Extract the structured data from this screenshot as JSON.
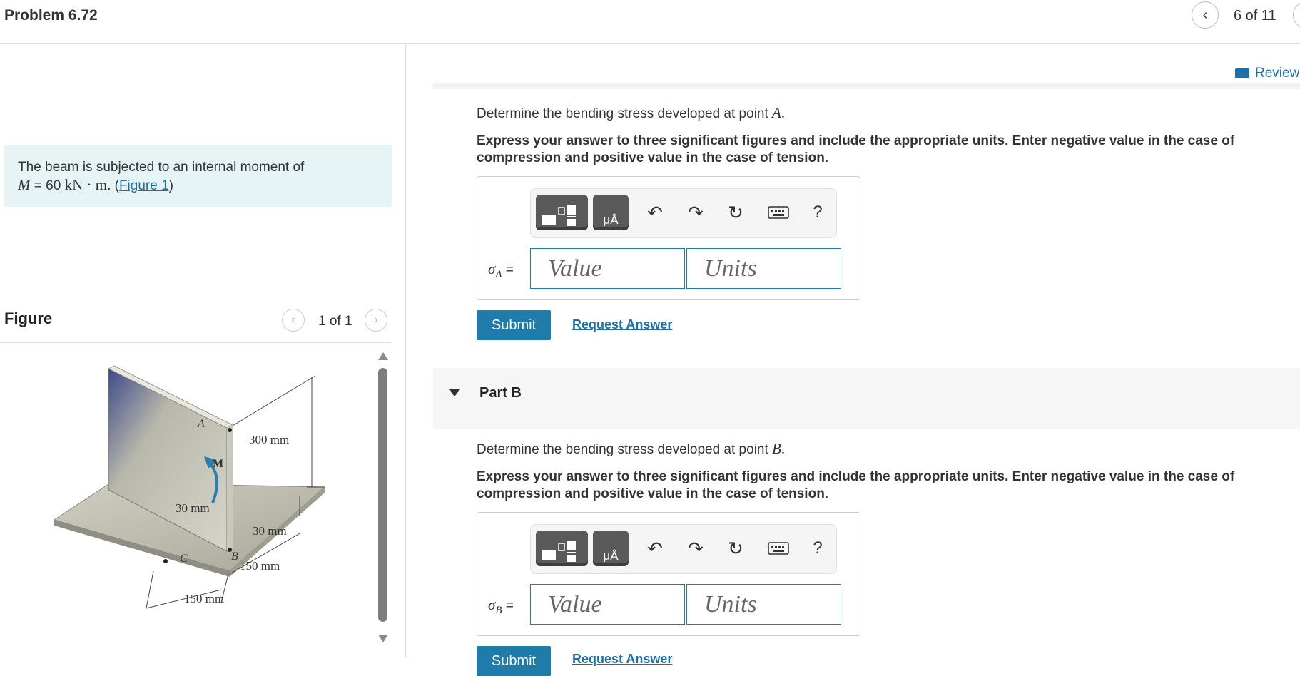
{
  "header": {
    "title": "Problem 6.72",
    "count": "6 of 11"
  },
  "prompt": {
    "text": "The beam is subjected to an internal moment of",
    "eq_var": "M",
    "eq_rest": " = 60 ",
    "eq_unit": "kN · m.",
    "figure_link": "Figure 1",
    "open_paren": " (",
    "close_paren": ")"
  },
  "figure_panel": {
    "label": "Figure",
    "count": "1 of 1",
    "labels": {
      "a": "A",
      "b": "B",
      "c": "C",
      "m": "M",
      "d300": "300 mm",
      "d30a": "30 mm",
      "d30b": "30 mm",
      "d150a": "150 mm",
      "d150b": "150 mm"
    }
  },
  "review": {
    "label": "Review"
  },
  "part_a": {
    "question": "Determine the bending stress developed at point ",
    "point": "A",
    "instructions": "Express your answer to three significant figures and include the appropriate units. Enter negative value in the case of compression and positive value in the case of tension.",
    "sigma": "σ",
    "sub": "A",
    "eq": " =",
    "value_placeholder": "Value",
    "units_placeholder": "Units",
    "submit": "Submit",
    "request": "Request Answer"
  },
  "part_b": {
    "heading": "Part B",
    "question": "Determine the bending stress developed at point ",
    "point": "B",
    "instructions": "Express your answer to three significant figures and include the appropriate units. Enter negative value in the case of compression and positive value in the case of tension.",
    "sigma": "σ",
    "sub": "B",
    "eq": " =",
    "value_placeholder": "Value",
    "units_placeholder": "Units",
    "submit": "Submit",
    "request": "Request Answer"
  },
  "toolbar": {
    "units_btn": "μÅ",
    "undo_icon": "undo-icon",
    "redo_icon": "redo-icon",
    "reset_icon": "reset-icon",
    "keyboard_icon": "keyboard-icon",
    "help": "?"
  }
}
